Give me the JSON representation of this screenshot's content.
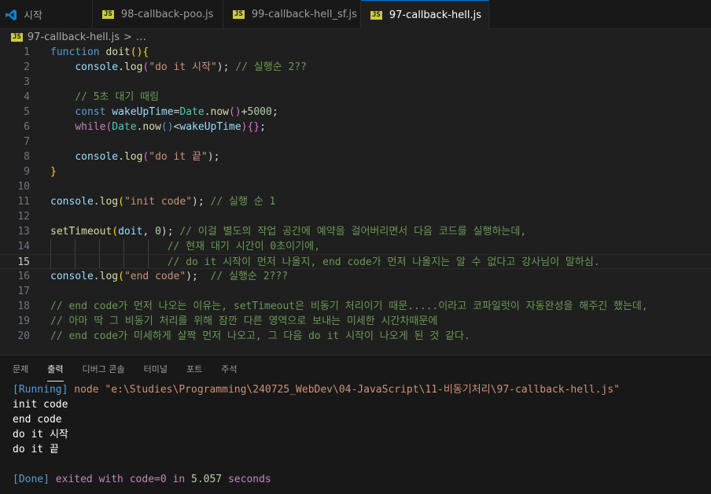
{
  "tabs": [
    {
      "label": "시작",
      "icon": "vscode-logo-icon"
    },
    {
      "label": "98-callback-poo.js",
      "icon": "js-file-icon"
    },
    {
      "label": "99-callback-hell_sf.js",
      "icon": "js-file-icon"
    },
    {
      "label": "97-callback-hell.js",
      "icon": "js-file-icon",
      "active": true,
      "unsaved": true
    }
  ],
  "breadcrumb": {
    "file": "97-callback-hell.js",
    "rest": "…",
    "sep": ">"
  },
  "js_badge": "JS",
  "editor": {
    "current_line": 15,
    "lines": [
      {
        "n": "1"
      },
      {
        "n": "2"
      },
      {
        "n": "3"
      },
      {
        "n": "4"
      },
      {
        "n": "5"
      },
      {
        "n": "6"
      },
      {
        "n": "7"
      },
      {
        "n": "8"
      },
      {
        "n": "9"
      },
      {
        "n": "10"
      },
      {
        "n": "11"
      },
      {
        "n": "12"
      },
      {
        "n": "13"
      },
      {
        "n": "14"
      },
      {
        "n": "15"
      },
      {
        "n": "16"
      },
      {
        "n": "17"
      },
      {
        "n": "18"
      },
      {
        "n": "19"
      },
      {
        "n": "20"
      }
    ],
    "tokens": {
      "l1": [
        "function",
        " ",
        "doit",
        "(",
        ")",
        "{"
      ],
      "l2": [
        "    ",
        "console",
        ".",
        "log",
        "(",
        "\"do it 시작\"",
        ");",
        " ",
        "// 실행순 2??"
      ],
      "l4": [
        "    ",
        "// 5초 대기 때림"
      ],
      "l5": [
        "    ",
        "const",
        " ",
        "wakeUpTime",
        "=",
        "Date",
        ".",
        "now",
        "()",
        "+",
        "5000",
        ";"
      ],
      "l6": [
        "    ",
        "while",
        "(",
        "Date",
        ".",
        "now",
        "()",
        "<",
        "wakeUpTime",
        ")",
        "{}",
        ";"
      ],
      "l8": [
        "    ",
        "console",
        ".",
        "log",
        "(",
        "\"do it 끝\"",
        ");"
      ],
      "l9": [
        "}"
      ],
      "l11": [
        "console",
        ".",
        "log",
        "(",
        "\"init code\"",
        ");",
        " ",
        "// 실행 순 1"
      ],
      "l13": [
        "setTimeout",
        "(",
        "doit",
        ", ",
        "0",
        ");",
        " ",
        "// 이걸 별도의 작업 공간에 예약을 걸어버리면서 다음 코드를 실행하는데,"
      ],
      "l14": [
        "                   ",
        "// 현재 대기 시간이 0초이기에,"
      ],
      "l15": [
        "                   ",
        "// do it 시작이 먼저 나올지, end code가 먼저 나올지는 알 수 없다고 강사님이 말하심."
      ],
      "l16": [
        "console",
        ".",
        "log",
        "(",
        "\"end code\"",
        ");",
        "  ",
        "// 실행순 2???"
      ],
      "l18": [
        "// end code가 먼저 나오는 이유는, setTimeout은 비동기 처리이기 때문.....이라고 코파일럿이 자동완성을 해주긴 했는데,"
      ],
      "l19": [
        "// 아마 딱 그 비동기 처리를 위해 잠깐 다른 영역으로 보내는 미세한 시간차때문에"
      ],
      "l20": [
        "// end code가 미세하게 살짝 먼저 나오고, 그 다음 do it 시작이 나오게 된 것 같다."
      ]
    }
  },
  "panel": {
    "tabs": [
      "문제",
      "출력",
      "디버그 콘솔",
      "터미널",
      "포트",
      "주석"
    ],
    "active_tab": "출력",
    "output": {
      "running_tag": "[Running]",
      "running_cmd": " node \"e:\\Studies\\Programming\\240725_WebDev\\04-JavaScript\\11-비동기처리\\97-callback-hell.js\"",
      "lines": [
        "init code",
        "end code",
        "do it 시작",
        "do it 끝"
      ],
      "done_tag": "[Done]",
      "done_text": " exited with ",
      "done_key": "code=0",
      "done_in": " in ",
      "done_secs": "5.057",
      "done_unit": " seconds"
    }
  },
  "colors": {
    "accent": "#0078d4",
    "editor_bg": "#1f1f1f",
    "panel_bg": "#181818"
  }
}
